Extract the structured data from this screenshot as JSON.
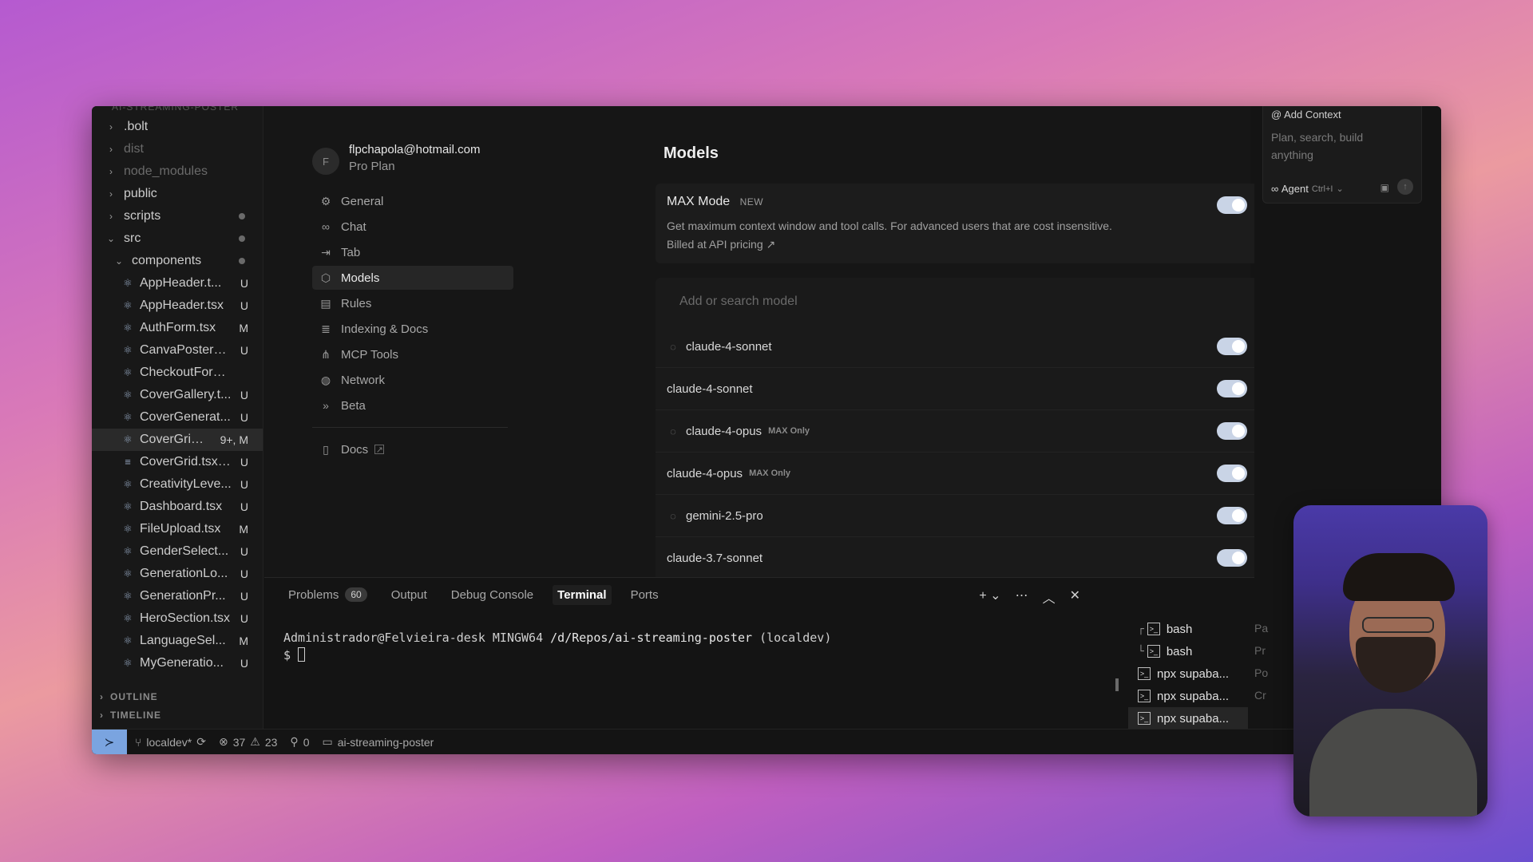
{
  "explorer": {
    "title": "AI-STREAMING-POSTER",
    "items": [
      {
        "label": ".bolt",
        "type": "folder",
        "depth": 0,
        "state": "collapsed"
      },
      {
        "label": "dist",
        "type": "folder",
        "depth": 0,
        "state": "collapsed",
        "dim": true
      },
      {
        "label": "node_modules",
        "type": "folder",
        "depth": 0,
        "state": "collapsed",
        "dim": true
      },
      {
        "label": "public",
        "type": "folder",
        "depth": 0,
        "state": "collapsed"
      },
      {
        "label": "scripts",
        "type": "folder",
        "depth": 0,
        "state": "collapsed",
        "dot": true
      },
      {
        "label": "src",
        "type": "folder",
        "depth": 0,
        "state": "expanded",
        "dot": true
      },
      {
        "label": "components",
        "type": "folder",
        "depth": 1,
        "state": "expanded",
        "dot": true
      },
      {
        "label": "AppHeader.t...",
        "type": "react",
        "badge": "U"
      },
      {
        "label": "AppHeader.tsx",
        "type": "react",
        "badge": "U"
      },
      {
        "label": "AuthForm.tsx",
        "type": "react",
        "badge": "M"
      },
      {
        "label": "CanvaPosterG...",
        "type": "react",
        "badge": "U"
      },
      {
        "label": "CheckoutForm.tsx",
        "type": "react",
        "badge": ""
      },
      {
        "label": "CoverGallery.t...",
        "type": "react",
        "badge": "U"
      },
      {
        "label": "CoverGenerat...",
        "type": "react",
        "badge": "U"
      },
      {
        "label": "CoverGrid...",
        "type": "react",
        "badge": "9+, M",
        "selected": true
      },
      {
        "label": "CoverGrid.tsx....",
        "type": "text",
        "badge": "U"
      },
      {
        "label": "CreativityLeve...",
        "type": "react",
        "badge": "U"
      },
      {
        "label": "Dashboard.tsx",
        "type": "react",
        "badge": "U"
      },
      {
        "label": "FileUpload.tsx",
        "type": "react",
        "badge": "M"
      },
      {
        "label": "GenderSelect...",
        "type": "react",
        "badge": "U"
      },
      {
        "label": "GenerationLo...",
        "type": "react",
        "badge": "U"
      },
      {
        "label": "GenerationPr...",
        "type": "react",
        "badge": "U"
      },
      {
        "label": "HeroSection.tsx",
        "type": "react",
        "badge": "U"
      },
      {
        "label": "LanguageSel...",
        "type": "react",
        "badge": "M"
      },
      {
        "label": "MyGeneratio...",
        "type": "react",
        "badge": "U"
      }
    ],
    "outline_label": "OUTLINE",
    "timeline_label": "TIMELINE"
  },
  "account": {
    "initial": "F",
    "email": "flpchapola@hotmail.com",
    "plan": "Pro Plan"
  },
  "nav": {
    "items": [
      {
        "label": "General",
        "icon": "gear-icon",
        "glyph": "⚙"
      },
      {
        "label": "Chat",
        "icon": "infinity-icon",
        "glyph": "∞"
      },
      {
        "label": "Tab",
        "icon": "tab-arrow-icon",
        "glyph": "⇥"
      },
      {
        "label": "Models",
        "icon": "cube-icon",
        "glyph": "⬡",
        "active": true
      },
      {
        "label": "Rules",
        "icon": "clipboard-icon",
        "glyph": "▤"
      },
      {
        "label": "Indexing & Docs",
        "icon": "database-icon",
        "glyph": "≣"
      },
      {
        "label": "MCP Tools",
        "icon": "network-nodes-icon",
        "glyph": "⋔"
      },
      {
        "label": "Network",
        "icon": "globe-icon",
        "glyph": "◍"
      },
      {
        "label": "Beta",
        "icon": "double-chevron-icon",
        "glyph": "»"
      }
    ],
    "docs_label": "Docs",
    "docs_ext": "↗"
  },
  "models": {
    "title": "Models",
    "max_mode": {
      "title": "MAX Mode",
      "badge": "NEW",
      "desc_line1": "Get maximum context window and tool calls. For advanced users that are cost insensitive.",
      "desc_line2": "Billed at API pricing ↗",
      "enabled": true
    },
    "search_placeholder": "Add or search model",
    "list": [
      {
        "name": "claude-4-sonnet",
        "thinking": true,
        "tag": "",
        "enabled": true
      },
      {
        "name": "claude-4-sonnet",
        "thinking": false,
        "tag": "",
        "enabled": true
      },
      {
        "name": "claude-4-opus",
        "thinking": true,
        "tag": "MAX Only",
        "enabled": true
      },
      {
        "name": "claude-4-opus",
        "thinking": false,
        "tag": "MAX Only",
        "enabled": true
      },
      {
        "name": "gemini-2.5-pro",
        "thinking": true,
        "tag": "",
        "enabled": true
      },
      {
        "name": "claude-3.7-sonnet",
        "thinking": false,
        "tag": "",
        "enabled": true
      }
    ]
  },
  "chat": {
    "add_context": "Add Context",
    "placeholder_line1": "Plan, search, build",
    "placeholder_line2": "anything",
    "agent_label": "Agent",
    "agent_shortcut": "Ctrl+I",
    "side_letters": [
      "Pa",
      "Pr",
      "Po",
      "Cr"
    ]
  },
  "panel": {
    "tabs": [
      {
        "label": "Problems",
        "count": "60"
      },
      {
        "label": "Output"
      },
      {
        "label": "Debug Console"
      },
      {
        "label": "Terminal",
        "active": true
      },
      {
        "label": "Ports"
      }
    ],
    "terminal": {
      "prompt_user": "Administrador@Felvieira-desk",
      "prompt_env": "MINGW64",
      "prompt_path": "/d/Repos/ai-streaming-poster",
      "prompt_branch": "(localdev)",
      "prompt_symbol": "$"
    },
    "terminals": [
      {
        "label": "bash",
        "branch": "┌"
      },
      {
        "label": "bash",
        "branch": "└"
      },
      {
        "label": "npx supaba...",
        "branch": ""
      },
      {
        "label": "npx supaba...",
        "branch": ""
      },
      {
        "label": "npx supaba...",
        "branch": "",
        "active": true
      }
    ]
  },
  "status": {
    "branch": "localdev*",
    "errors": "37",
    "warnings": "23",
    "ports": "0",
    "folder": "ai-streaming-poster"
  },
  "colors": {
    "toggle_on": "#c9d4e6",
    "remote_accent": "#7aa4e0"
  }
}
